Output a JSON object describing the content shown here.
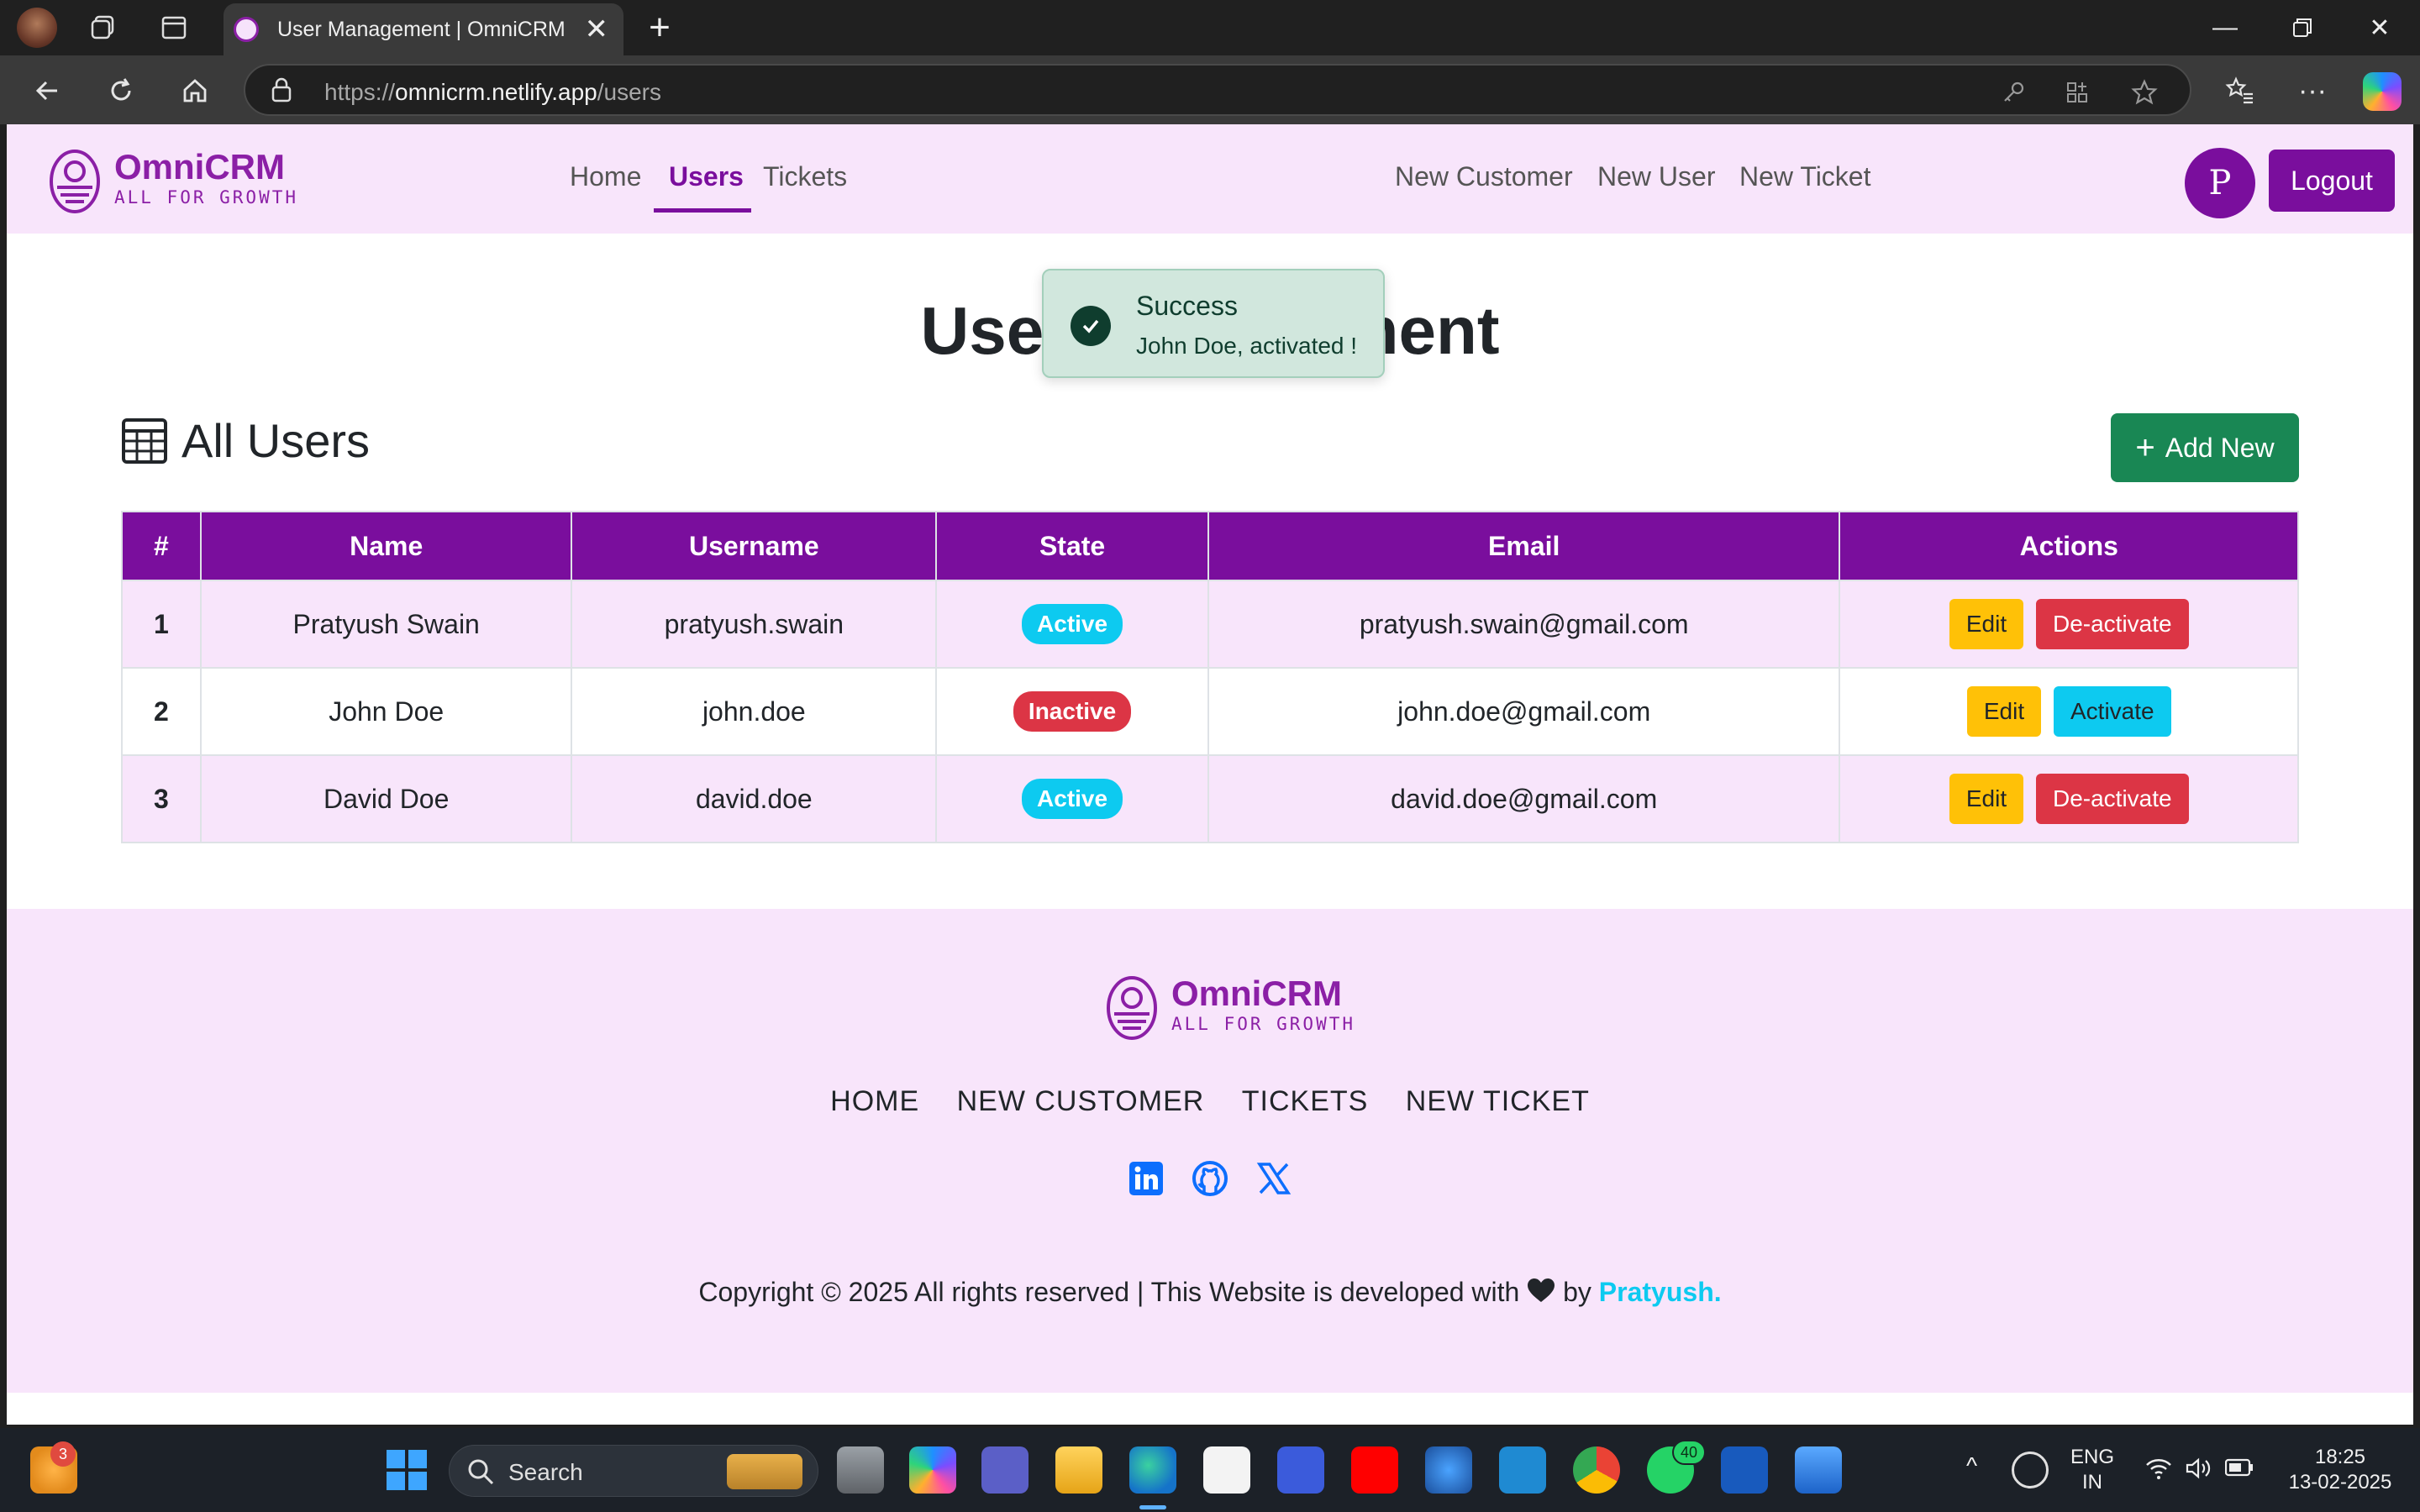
{
  "browser": {
    "tab_title": "User Management | OmniCRM",
    "url_scheme": "https://",
    "url_host": "omnicrm.netlify.app",
    "url_path": "/users"
  },
  "navbar": {
    "brand_name": "OmniCRM",
    "brand_tagline": "ALL FOR GROWTH",
    "links": [
      "Home",
      "Users",
      "Tickets"
    ],
    "active_link": "Users",
    "right_links": [
      "New Customer",
      "New User",
      "New Ticket"
    ],
    "avatar_initial": "P",
    "logout_label": "Logout"
  },
  "page": {
    "title": "User Management",
    "section_title": "All Users",
    "add_new_label": "Add New"
  },
  "table": {
    "headers": [
      "#",
      "Name",
      "Username",
      "State",
      "Email",
      "Actions"
    ],
    "rows": [
      {
        "num": "1",
        "name": "Pratyush Swain",
        "username": "pratyush.swain",
        "state": "Active",
        "email": "pratyush.swain@gmail.com",
        "edit": "Edit",
        "toggle": "De-activate"
      },
      {
        "num": "2",
        "name": "John Doe",
        "username": "john.doe",
        "state": "Inactive",
        "email": "john.doe@gmail.com",
        "edit": "Edit",
        "toggle": "Activate"
      },
      {
        "num": "3",
        "name": "David Doe",
        "username": "david.doe",
        "state": "Active",
        "email": "david.doe@gmail.com",
        "edit": "Edit",
        "toggle": "De-activate"
      }
    ]
  },
  "toast": {
    "title": "Success",
    "message": "John Doe, activated !"
  },
  "footer": {
    "links": [
      "HOME",
      "NEW CUSTOMER",
      "TICKETS",
      "NEW TICKET"
    ],
    "copyright_before": "Copyright © 2025 All rights reserved | This Website is developed with",
    "copyright_by": "by",
    "author": "Pratyush."
  },
  "taskbar": {
    "search_label": "Search",
    "widget_badge": "3",
    "whatsapp_badge": "40",
    "lang_line1": "ENG",
    "lang_line2": "IN",
    "time": "18:25",
    "date": "13-02-2025"
  },
  "colors": {
    "brand": "#7a0e9d",
    "navbar_bg": "#f8e5fb",
    "success": "#198754",
    "active_badge": "#0dcaf0",
    "danger": "#dc3545",
    "warning": "#ffc107"
  }
}
